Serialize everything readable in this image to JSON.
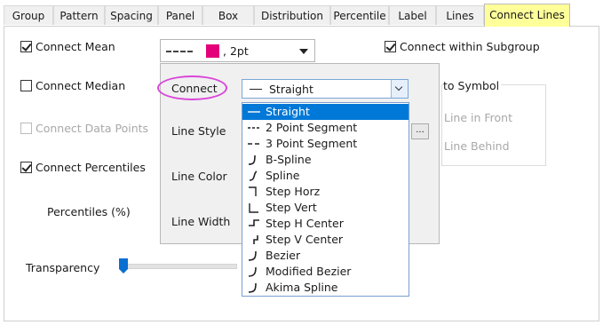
{
  "tabs": [
    "Group",
    "Pattern",
    "Spacing",
    "Panel",
    "Box",
    "Distribution",
    "Percentile",
    "Label",
    "Lines",
    "Connect Lines"
  ],
  "active_tab": "Connect Lines",
  "options": {
    "connect_mean": "Connect Mean",
    "connect_median": "Connect Median",
    "connect_data_points": "Connect Data Points",
    "connect_percentiles": "Connect Percentiles",
    "percentiles_label": "Percentiles (%)",
    "transparency_label": "Transparency",
    "connect_within_subgroup": "Connect within Subgroup",
    "to_symbol": "to Symbol",
    "line_in_front": "Line in Front",
    "line_behind": "Line Behind"
  },
  "line_combo": {
    "value": ", 2pt",
    "color": "#e3007a"
  },
  "flyout": {
    "connect_label": "Connect",
    "line_style_label": "Line Style",
    "line_color_label": "Line Color",
    "line_width_label": "Line Width",
    "connect_value": "Straight",
    "ellipsis": "..."
  },
  "connect_options": [
    {
      "label": "Straight",
      "icon": "straight-icon"
    },
    {
      "label": "2 Point Segment",
      "icon": "2-point-segment-icon"
    },
    {
      "label": "3 Point Segment",
      "icon": "3-point-segment-icon"
    },
    {
      "label": "B-Spline",
      "icon": "b-spline-icon"
    },
    {
      "label": "Spline",
      "icon": "spline-icon"
    },
    {
      "label": "Step Horz",
      "icon": "step-horz-icon"
    },
    {
      "label": "Step Vert",
      "icon": "step-vert-icon"
    },
    {
      "label": "Step H Center",
      "icon": "step-h-center-icon"
    },
    {
      "label": "Step V Center",
      "icon": "step-v-center-icon"
    },
    {
      "label": "Bezier",
      "icon": "bezier-icon"
    },
    {
      "label": "Modified Bezier",
      "icon": "modified-bezier-icon"
    },
    {
      "label": "Akima Spline",
      "icon": "akima-spline-icon"
    }
  ],
  "selected_connect": "Straight",
  "checked": {
    "connect_mean": true,
    "connect_median": false,
    "connect_data_points": false,
    "connect_percentiles": true,
    "connect_within_subgroup": true
  },
  "transparency_fraction": 0
}
